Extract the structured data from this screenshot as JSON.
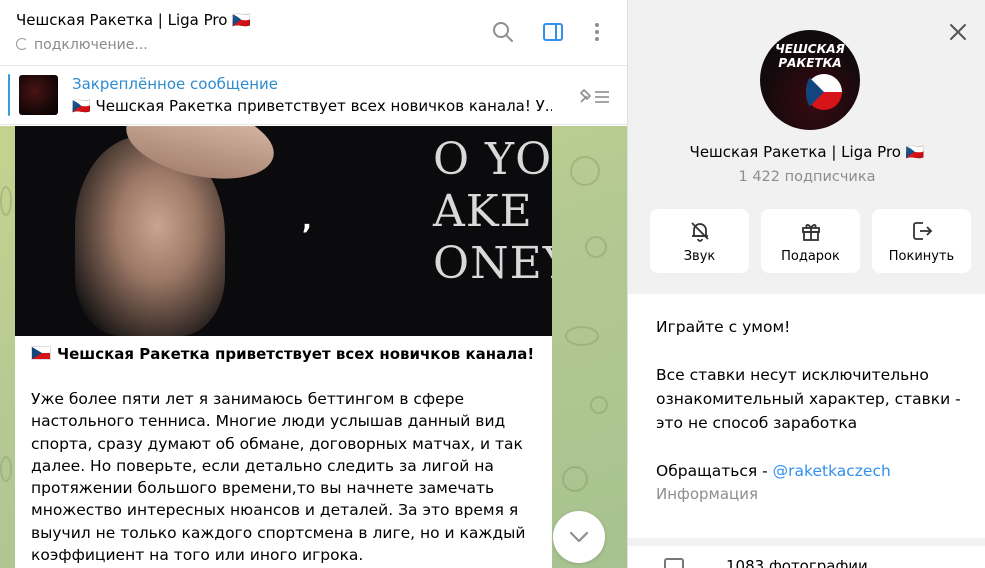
{
  "chat": {
    "title": "Чешская Ракетка | Liga Pro 🇨🇿",
    "status": "подключение...",
    "pinned": {
      "title": "Закреплённое сообщение",
      "text": "🇨🇿 Чешская Ракетка приветствует всех новичков канала!  У..."
    },
    "message": {
      "media_text": "O YOU\nAKE\nONEY",
      "media_glyph": ",",
      "headline": "Чешская Ракетка приветствует всех новичков канала!",
      "body": "Уже более пяти лет я занимаюсь беттингом в сфере настольного тенниса. Многие люди услышав данный вид спорта, сразу думают об обмане, договорных матчах, и так далее. Но поверьте, если детально следить за лигой на протяжении большого времени,то вы начнете замечать множество интересных нюансов и деталей. За это время я выучил не только каждого спортсмена в лиге, но и каждый коэффициент на того или иного игрока."
    }
  },
  "profile": {
    "avatar_text": "ЧЕШСКАЯ РАКЕТКА",
    "name": "Чешская Ракетка | Liga Pro 🇨🇿",
    "subscribers": "1 422 подписчика",
    "actions": [
      {
        "label": "Звук",
        "icon": "bell-off-icon"
      },
      {
        "label": "Подарок",
        "icon": "gift-icon"
      },
      {
        "label": "Покинуть",
        "icon": "leave-icon"
      }
    ],
    "info": {
      "line1": "Играйте с умом!",
      "line2": "Все ставки несут исключительно ознакомительный характер, ставки - это не способ заработка",
      "contact_prefix": "Обращаться - ",
      "contact_link": "@raketkaczech",
      "label": "Информация"
    },
    "media_row_label": "1083 фотографии"
  },
  "colors": {
    "accent": "#3390ec",
    "pinned_title": "#2d8ccf",
    "chat_bg": "#b4c992"
  }
}
